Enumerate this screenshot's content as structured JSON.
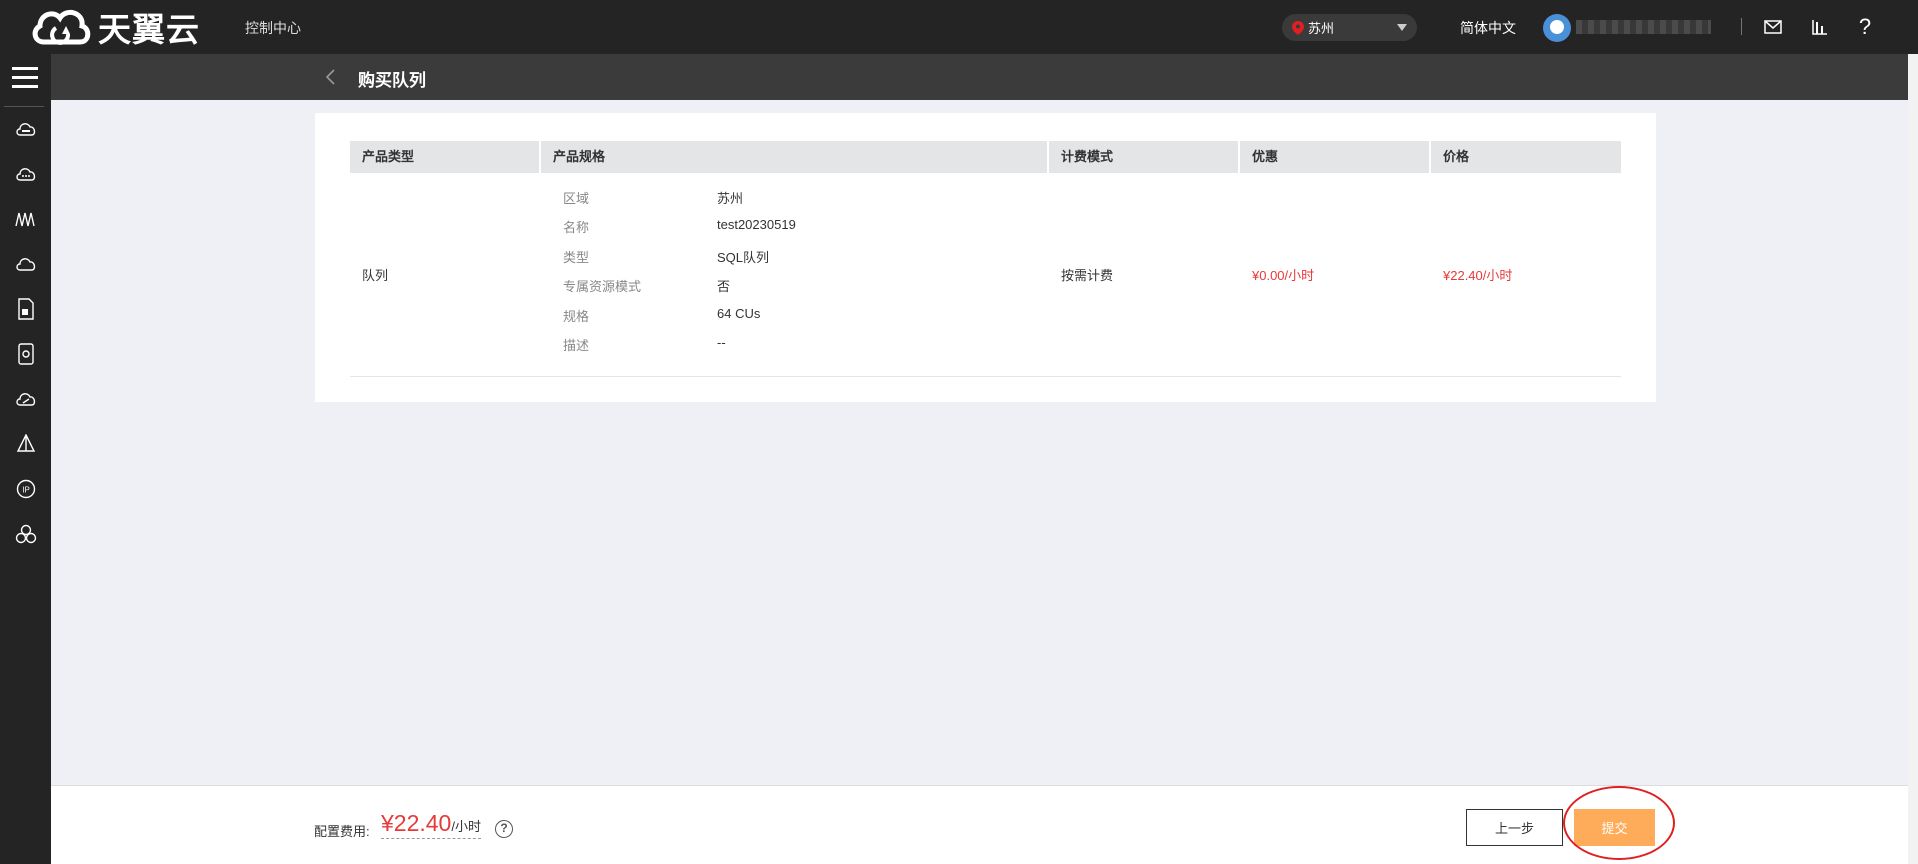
{
  "topbar": {
    "logo_text": "天翼云",
    "console_link": "控制中心",
    "region": "苏州",
    "language": "简体中文",
    "icons": [
      "mail-icon",
      "chart-icon",
      "help-icon"
    ]
  },
  "sidebar": {
    "items": [
      "cloud-server-icon",
      "cloud-disk-icon",
      "network-icon",
      "cloud-icon",
      "document-icon",
      "storage-icon",
      "cloud-link-icon",
      "triangle-icon",
      "ip-icon",
      "cluster-icon"
    ]
  },
  "subheader": {
    "title": "购买队列"
  },
  "table": {
    "headers": [
      "产品类型",
      "产品规格",
      "计费模式",
      "优惠",
      "价格"
    ],
    "row": {
      "product_type": "队列",
      "specs": [
        {
          "label": "区域",
          "value": "苏州"
        },
        {
          "label": "名称",
          "value": "test20230519"
        },
        {
          "label": "类型",
          "value": "SQL队列"
        },
        {
          "label": "专属资源模式",
          "value": "否"
        },
        {
          "label": "规格",
          "value": "64 CUs"
        },
        {
          "label": "描述",
          "value": "--"
        }
      ],
      "billing_mode": "按需计费",
      "discount": "¥0.00/小时",
      "price": "¥22.40/小时"
    }
  },
  "footer": {
    "fee_label": "配置费用:",
    "fee_amount": "¥22.40",
    "fee_unit": "/小时",
    "help": "?",
    "prev_button": "上一步",
    "submit_button": "提交"
  },
  "colors": {
    "accent_red": "#e63a3a",
    "submit_orange": "#ffac5a",
    "topbar_bg": "#242424"
  }
}
